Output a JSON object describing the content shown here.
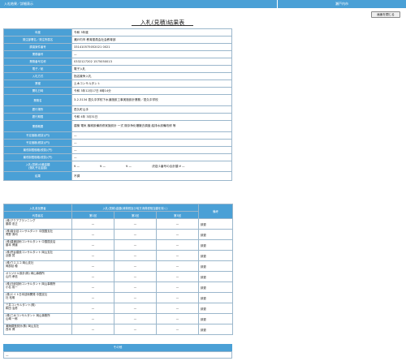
{
  "topbar": {
    "left": "入札結果／詳細表示",
    "right": "瀬戸内市"
  },
  "back_button": "画面を閉じる",
  "page_title": "入札(見積)結果表",
  "fields": [
    {
      "label": "年度",
      "value": "令和 3年度"
    },
    {
      "label": "発注部署名／発注所属名",
      "value": "瀬戸内市 教育委員会社会教育部"
    },
    {
      "label": "調達案件番号",
      "value": "331410575052021 0021"
    },
    {
      "label": "業務番号",
      "value": "—"
    },
    {
      "label": "業務番号名称",
      "value": "0332127202 1575050013"
    },
    {
      "label": "電子／紙",
      "value": "電子入札"
    },
    {
      "label": "入札方式",
      "value": "指名競争入札"
    },
    {
      "label": "業種",
      "value": "土木コンサルタント"
    },
    {
      "label": "開札日時",
      "value": "令和 3年12月17日 8時14分"
    },
    {
      "label": "業務名",
      "value": "3-2-3134 邑久中学校下水道施設工事実施設計業務／邑久中学校"
    },
    {
      "label": "履行場所",
      "value": "邑久町山手"
    },
    {
      "label": "履行期限",
      "value": "令和 4年 3月31日"
    },
    {
      "label": "業務概要",
      "value": "建築 電気 機械設備改修実施設計 一式 既存浄化槽撤去調査 給排水設備改修 等"
    },
    {
      "label": "予定価格(税抜)(円)",
      "value": "—"
    },
    {
      "label": "予定価格(税抜)(円)",
      "value": "—"
    },
    {
      "label": "最低制限価格(税抜)(円)",
      "value": "—"
    },
    {
      "label": "最低制限価格(税抜)(円)",
      "value": "—"
    }
  ],
  "bid_row": {
    "label": "入札(見積)の最高額\n(落札予定金額)",
    "cells": [
      "¥ —",
      "¥ —",
      "¥ —",
      "決定(1番号の合計額 ¥ —"
    ]
  },
  "result_row": {
    "label": "結果",
    "value": "不調"
  },
  "sub_table": {
    "headers": [
      "入札参加業者",
      "入札(見積)金額(消費税及び地方消費税相当額を除く)",
      "備考"
    ],
    "subheaders": [
      "代表者名",
      "第1回",
      "第2回",
      "第3回"
    ],
    "rows": [
      {
        "company": "(株)アクアプランニング",
        "rep": "藤原 忠正",
        "r1": "—",
        "r2": "—",
        "r3": "—",
        "note": "辞退"
      },
      {
        "company": "(株)複合技コンサルタント 中国国支社",
        "rep": "青野 清司",
        "r1": "—",
        "r2": "—",
        "r3": "—",
        "note": "辞退"
      },
      {
        "company": "(株)建通技術コンサルタント 中国国支店",
        "rep": "藤本 博道",
        "r1": "—",
        "r2": "—",
        "r3": "—",
        "note": "辞退"
      },
      {
        "company": "(株)荒谷建設コンサルタント 岡山支社",
        "rep": "近藤 賢",
        "r1": "—",
        "r2": "—",
        "r3": "—",
        "note": "辞退"
      },
      {
        "company": "(株)ウエスコ 岡山支社",
        "rep": "両部延 穂",
        "r1": "—",
        "r2": "—",
        "r3": "—",
        "note": "辞退"
      },
      {
        "company": "オリジナル設計(株) 岡山事務所",
        "rep": "山内 孝信",
        "r1": "—",
        "r2": "—",
        "r3": "—",
        "note": "辞退"
      },
      {
        "company": "(株)日総技術コンサルタント 岡山事務所",
        "rep": "小名 成一",
        "r1": "—",
        "r2": "—",
        "r3": "—",
        "note": "辞退"
      },
      {
        "company": "(株)エイト日本技術開発 中国支社",
        "rep": "社 松明",
        "r1": "—",
        "r2": "—",
        "r3": "—",
        "note": "辞退"
      },
      {
        "company": "三井コンサルタント(株)",
        "rep": "和田 治男",
        "r1": "—",
        "r2": "—",
        "r3": "—",
        "note": "辞退"
      },
      {
        "company": "(株)三水コンサルタント 岡山事務所",
        "rep": "山崎 一郎",
        "r1": "—",
        "r2": "—",
        "r3": "—",
        "note": "辞退"
      },
      {
        "company": "潮海調査設計(株) 岡山支社",
        "rep": "西本 博",
        "r1": "—",
        "r2": "—",
        "r3": "—",
        "note": "辞退"
      }
    ]
  },
  "other": {
    "label": "その他",
    "value": "—"
  }
}
